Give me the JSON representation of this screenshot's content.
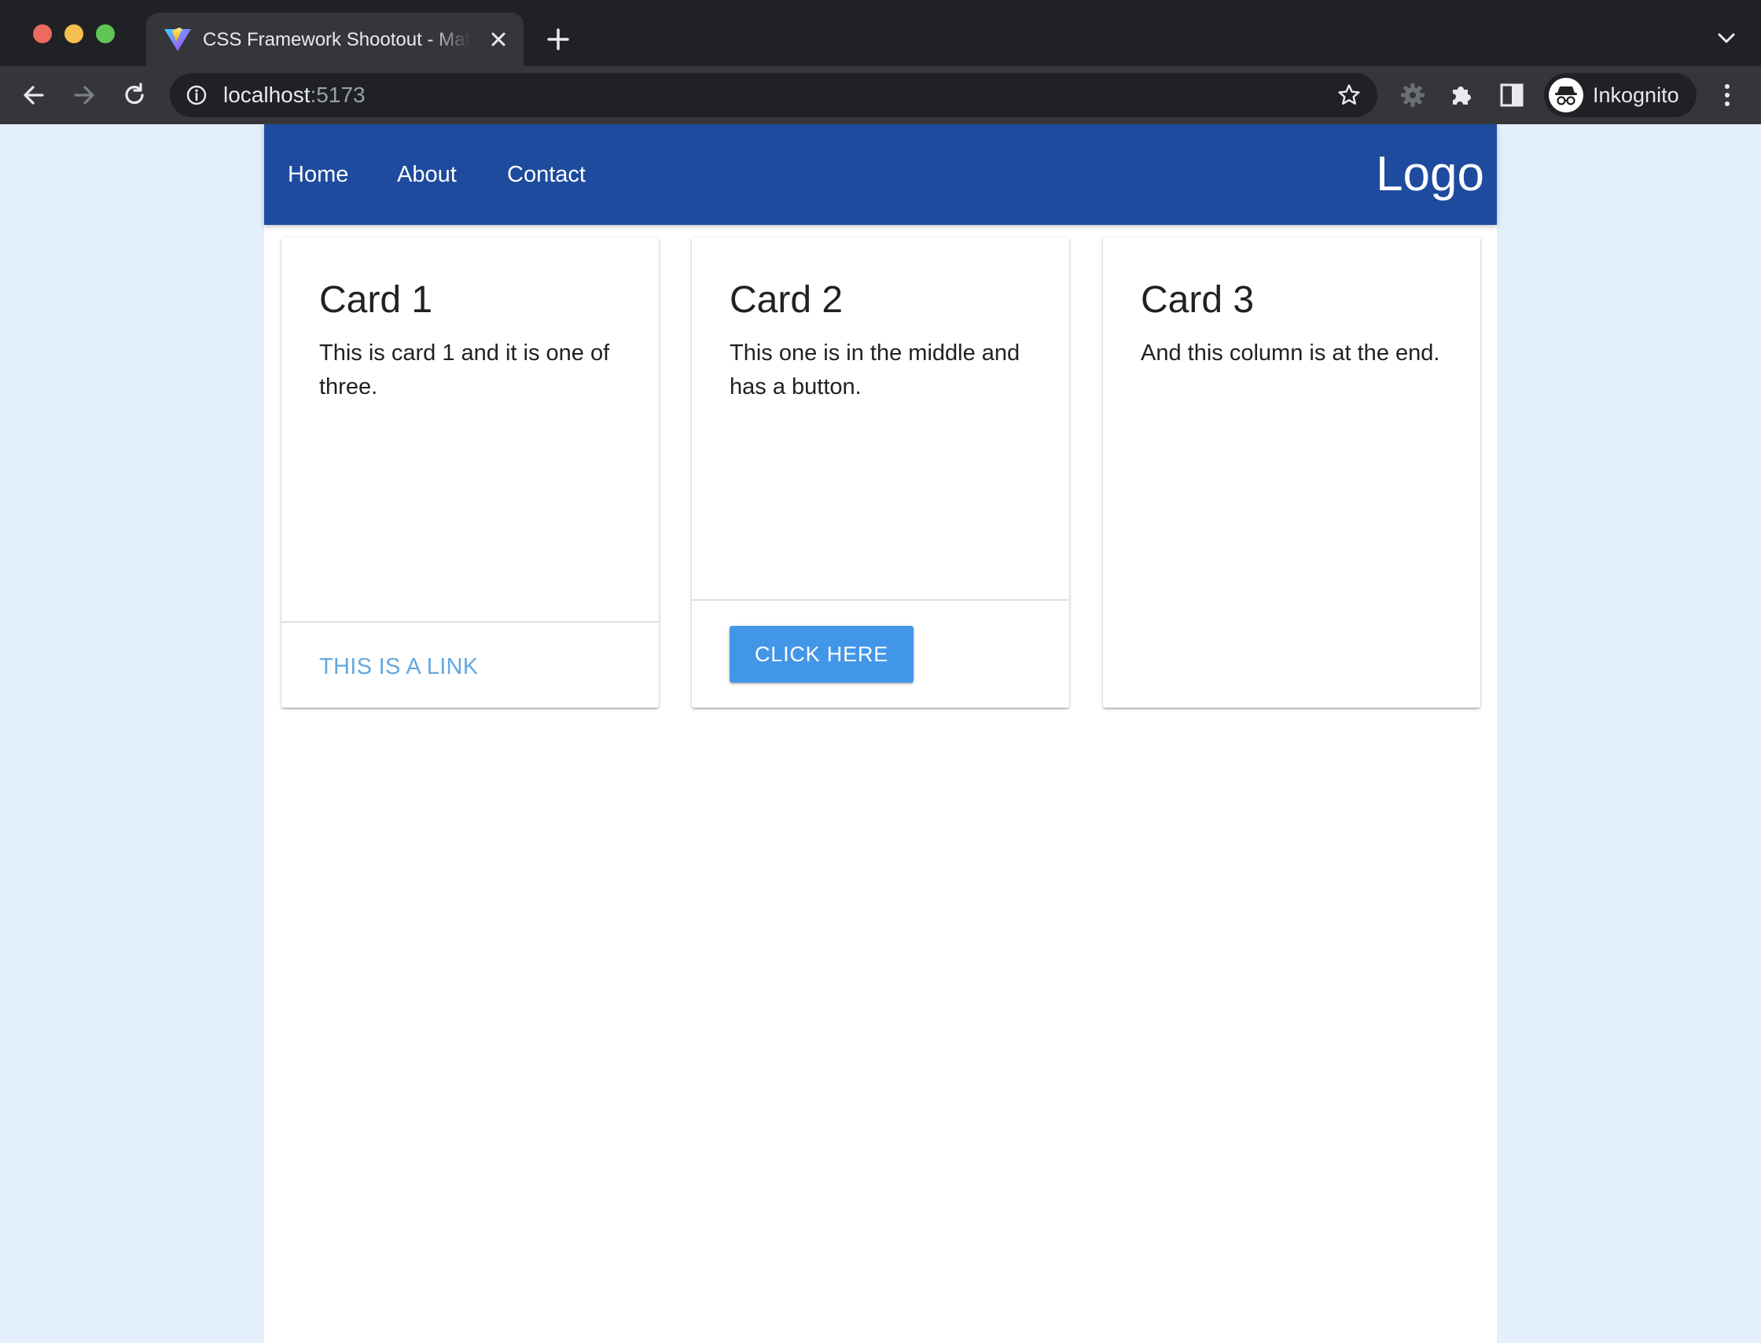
{
  "browser": {
    "tab": {
      "title": "CSS Framework Shootout - Materialize",
      "favicon": "vite-logo-icon",
      "close_icon": "close-icon"
    },
    "new_tab_icon": "plus-icon",
    "tab_list_icon": "chevron-down-icon",
    "toolbar": {
      "back_icon": "arrow-left-icon",
      "forward_icon": "arrow-right-icon",
      "reload_icon": "reload-icon",
      "url_host": "localhost",
      "url_port": ":5173",
      "site_info_icon": "info-icon",
      "bookmark_icon": "star-icon",
      "extension_icons": [
        "gear-icon",
        "puzzle-icon"
      ],
      "side_panel_icon": "side-panel-icon",
      "profile_label": "Inkognito",
      "profile_icon": "incognito-icon",
      "menu_icon": "kebab-menu-icon"
    }
  },
  "page": {
    "nav": {
      "links": [
        "Home",
        "About",
        "Contact"
      ],
      "brand": "Logo",
      "color": "#1e4b9e"
    },
    "cards": [
      {
        "title": "Card 1",
        "text": "This is card 1 and it is one of three.",
        "action_link": "This is a link"
      },
      {
        "title": "Card 2",
        "text": "This one is in the middle and has a button.",
        "action_button": "Click here",
        "button_color": "#4296e8"
      },
      {
        "title": "Card 3",
        "text": "And this column is at the end."
      }
    ],
    "background_color": "#e3effb"
  }
}
